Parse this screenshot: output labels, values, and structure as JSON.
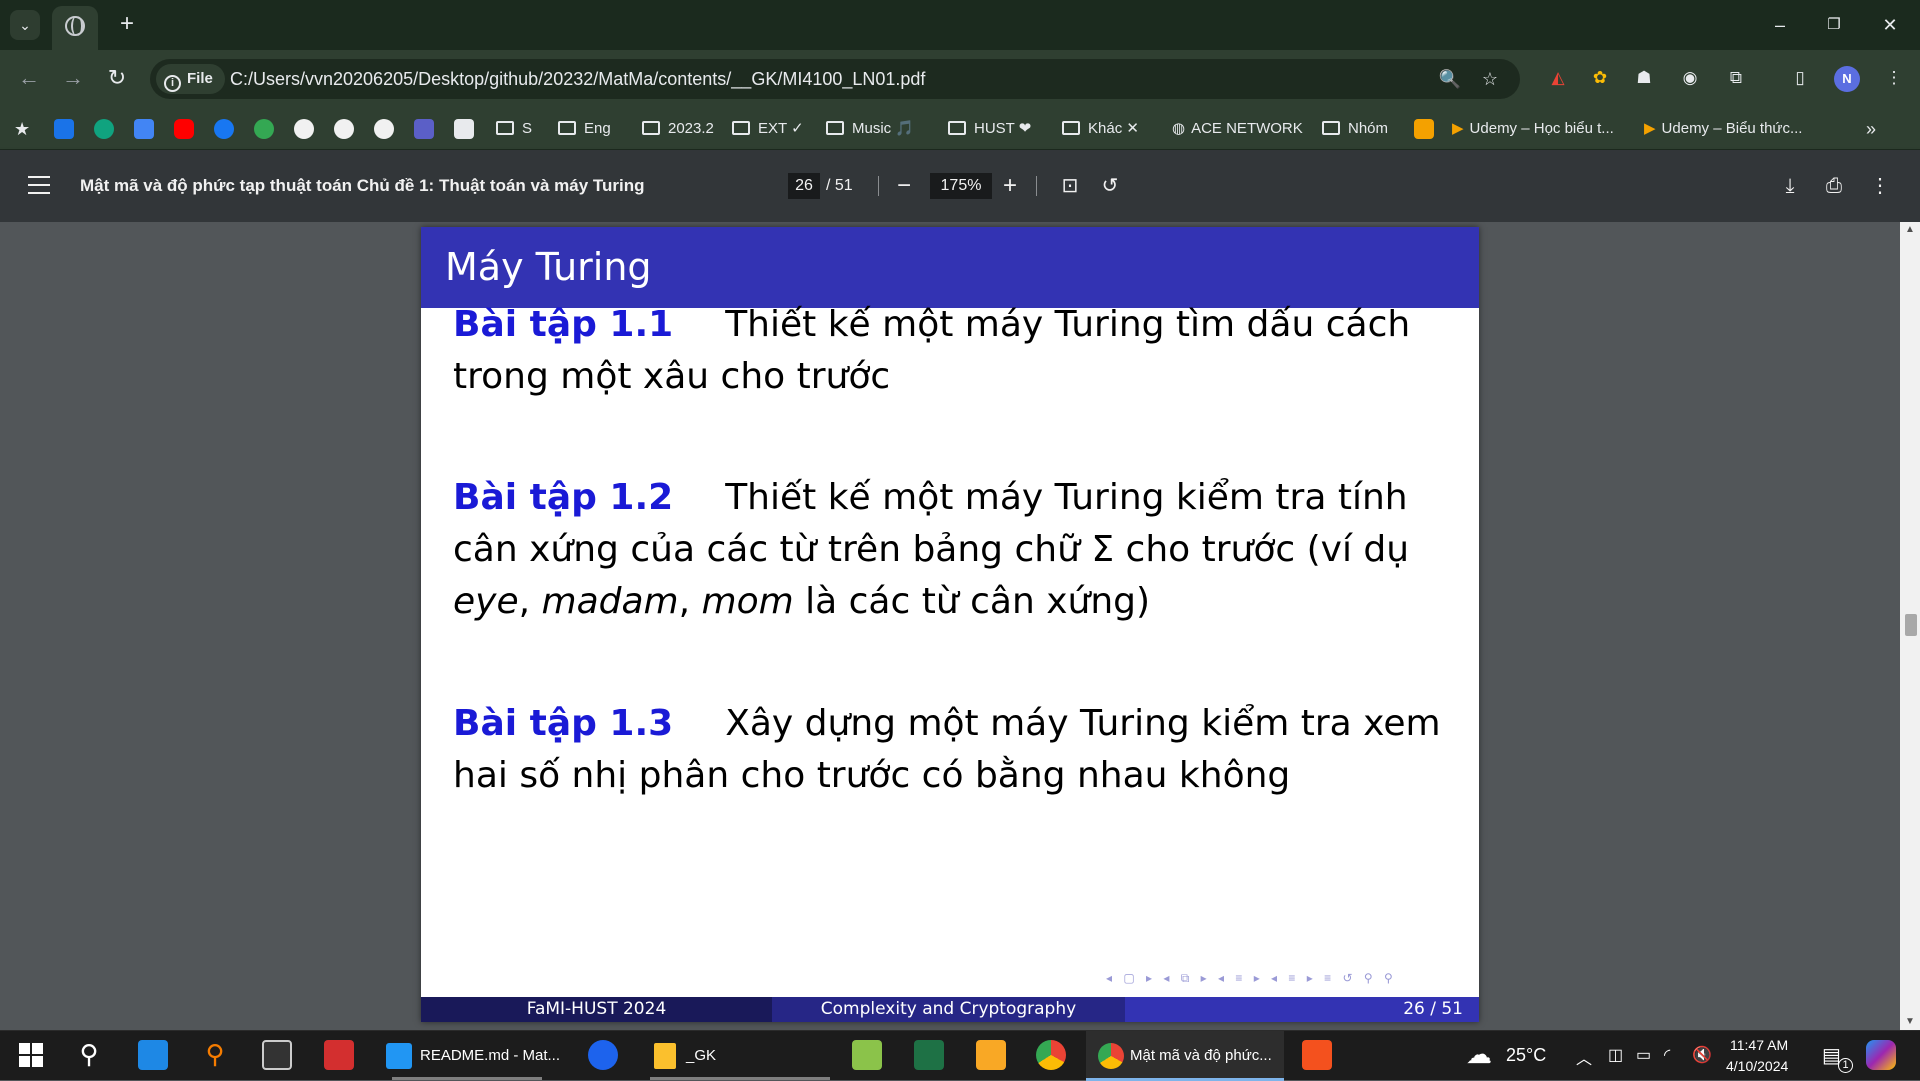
{
  "browser": {
    "tab_dropdown_icon": "chevron-down-icon",
    "new_tab": "+",
    "window_controls": {
      "minimize": "–",
      "restore": "❐",
      "close": "✕"
    }
  },
  "toolbar": {
    "file_chip": "File",
    "url": "C:/Users/vvn20206205/Desktop/github/20232/MatMa/contents/__GK/MI4100_LN01.pdf",
    "avatar_initial": "N"
  },
  "bookmarks": {
    "folders": [
      {
        "label": "S"
      },
      {
        "label": "Eng"
      },
      {
        "label": "2023.2"
      },
      {
        "label": "EXT ✓"
      },
      {
        "label": "Music 🎵"
      },
      {
        "label": "HUST ❤"
      },
      {
        "label": "Khác ✕"
      }
    ],
    "ace_network": "ACE NETWORK",
    "nhom": "Nhóm",
    "udemy1": "Udemy – Học biểu t...",
    "udemy2": "Udemy – Biểu thức...",
    "more": "»"
  },
  "pdf": {
    "title": "Mật mã và độ phức tạp thuật toán Chủ đề 1: Thuật toán và máy Turing",
    "current_page": "26",
    "total_pages": "/ 51",
    "zoom": "175%"
  },
  "slide": {
    "title": "Máy Turing",
    "exercises": [
      {
        "label": "Bài tập 1.1",
        "line1": "Thiết kế một máy Turing tìm dấu cách",
        "line2": "trong một xâu cho trước"
      },
      {
        "label": "Bài tập 1.2",
        "line1": "Thiết kế một máy Turing kiểm tra tính",
        "line2": "cân xứng của các từ trên bảng chữ Σ cho trước (ví dụ",
        "ex_a": "eye",
        "ex_b": "madam",
        "ex_c": "mom",
        "line3_rest": "là các từ cân xứng)"
      },
      {
        "label": "Bài tập 1.3",
        "line1": "Xây dựng một máy Turing kiểm tra xem",
        "line2": "hai số nhị phân cho trước có bằng nhau không"
      }
    ],
    "footer": {
      "left": "FaMI-HUST 2024",
      "center": "Complexity and Cryptography",
      "right": "26 / 51"
    }
  },
  "taskbar": {
    "apps": [
      {
        "label": "README.md - Mat..."
      },
      {
        "label": "_GK"
      },
      {
        "label": "Mật mã và độ phức..."
      }
    ],
    "weather": "25°C",
    "time": "11:47 AM",
    "date": "4/10/2024",
    "notification_count": "1"
  }
}
